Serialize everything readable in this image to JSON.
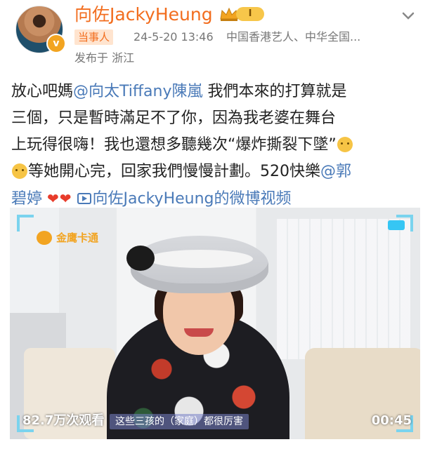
{
  "post": {
    "author": "向佐JackyHeung",
    "level_badge": "I",
    "tag": "当事人",
    "timestamp": "24-5-20 13:46",
    "author_desc": "中国香港艺人、中华全国...",
    "location": "发布于 浙江",
    "lines": [
      [
        "放心吧媽",
        "@向太Tiffany陳嵐",
        " 我們本來的打算就是"
      ],
      [
        "三個，只是暫時滿足不了你，因為我老婆在舞台"
      ],
      [
        "上玩得很嗨！我也還想多聽幾次“爆炸撕裂下墜”"
      ],
      [
        "等她開心完，回家我們慢慢計劃。520快樂",
        "@郭"
      ],
      [
        "碧婷",
        "向佐JackyHeung的微博视频"
      ]
    ],
    "hearts": "❤❤",
    "avatar_badge": "v"
  },
  "video": {
    "channel_logo": "金鹰卡通",
    "views": "82.7万次观看",
    "subtitle": "这些三孩的（家庭）都很厉害",
    "duration": "00:45"
  },
  "colors": {
    "brand_orange": "#f26d1e",
    "link_blue": "#4a7ab8",
    "frame_cyan": "#7ad3ee"
  }
}
